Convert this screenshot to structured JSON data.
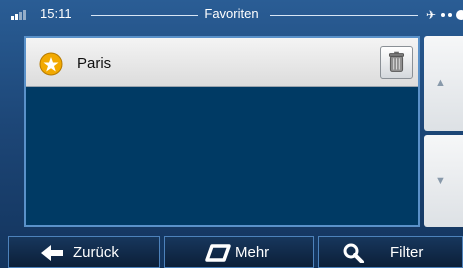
{
  "statusbar": {
    "time": "15:11",
    "title": "Favoriten"
  },
  "favorites": {
    "items": [
      {
        "label": "Paris",
        "icon": "favorite-star-icon"
      }
    ]
  },
  "scroll": {
    "up_icon": "scroll-up-icon",
    "down_icon": "scroll-down-icon"
  },
  "bottom_bar": {
    "back_label": "Zurück",
    "more_label": "Mehr",
    "filter_label": "Filter"
  },
  "colors": {
    "list_background": "#003a64",
    "accent_border": "#5a91c9",
    "star_badge": "#f2a900"
  }
}
